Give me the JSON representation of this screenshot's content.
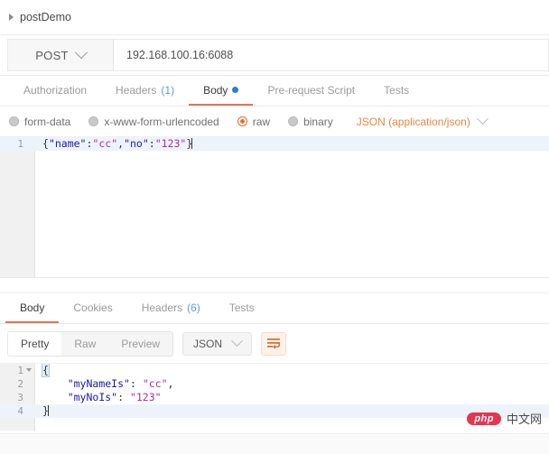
{
  "breadcrumb": {
    "label": "postDemo",
    "arrow_icon": "triangle-right-icon"
  },
  "request": {
    "method": "POST",
    "method_chevron_icon": "chevron-down-icon",
    "url": "192.168.100.16:6088",
    "tabs": [
      {
        "label": "Authorization",
        "active": false,
        "count": ""
      },
      {
        "label": "Headers",
        "active": false,
        "count": "(1)"
      },
      {
        "label": "Body",
        "active": true,
        "count": "",
        "dot": true
      },
      {
        "label": "Pre-request Script",
        "active": false,
        "count": ""
      },
      {
        "label": "Tests",
        "active": false,
        "count": ""
      }
    ],
    "body_types": [
      {
        "label": "form-data",
        "selected": false
      },
      {
        "label": "x-www-form-urlencoded",
        "selected": false
      },
      {
        "label": "raw",
        "selected": true
      },
      {
        "label": "binary",
        "selected": false
      }
    ],
    "content_type": "JSON (application/json)",
    "content_type_chevron_icon": "chevron-down-icon",
    "editor": {
      "line_number": "1",
      "code_open_brace": "{",
      "code_key_name": "\"name\"",
      "code_colon_1": ":",
      "code_val_cc": "\"cc\"",
      "code_comma": ",",
      "code_key_no": "\"no\"",
      "code_colon_2": ":",
      "code_val_123": "\"123\"",
      "code_close_brace": "}"
    }
  },
  "response": {
    "tabs": [
      {
        "label": "Body",
        "active": true,
        "count": ""
      },
      {
        "label": "Cookies",
        "active": false,
        "count": ""
      },
      {
        "label": "Headers",
        "active": false,
        "count": "(6)"
      },
      {
        "label": "Tests",
        "active": false,
        "count": ""
      }
    ],
    "view_modes": [
      {
        "label": "Pretty",
        "active": true
      },
      {
        "label": "Raw",
        "active": false
      },
      {
        "label": "Preview",
        "active": false
      }
    ],
    "format": "JSON",
    "format_chevron_icon": "chevron-down-icon",
    "wrap_icon": "word-wrap-icon",
    "body_lines": [
      {
        "num": "1",
        "fold": true,
        "indent": 0,
        "text": "{"
      },
      {
        "num": "2",
        "fold": false,
        "indent": 1,
        "key": "\"myNameIs\"",
        "sep": ": ",
        "value": "\"cc\"",
        "tail": ","
      },
      {
        "num": "3",
        "fold": false,
        "indent": 1,
        "key": "\"myNoIs\"",
        "sep": ": ",
        "value": "\"123\"",
        "tail": ""
      },
      {
        "num": "4",
        "fold": false,
        "indent": 0,
        "text": "}"
      }
    ]
  },
  "watermark": {
    "badge": "php",
    "text": "中文网"
  },
  "colors": {
    "accent_orange": "#e8734a",
    "link_blue": "#5c9fd6",
    "json_key": "#1a1aaa",
    "json_value": "#a333a3",
    "active_line": "#eef3fb"
  }
}
